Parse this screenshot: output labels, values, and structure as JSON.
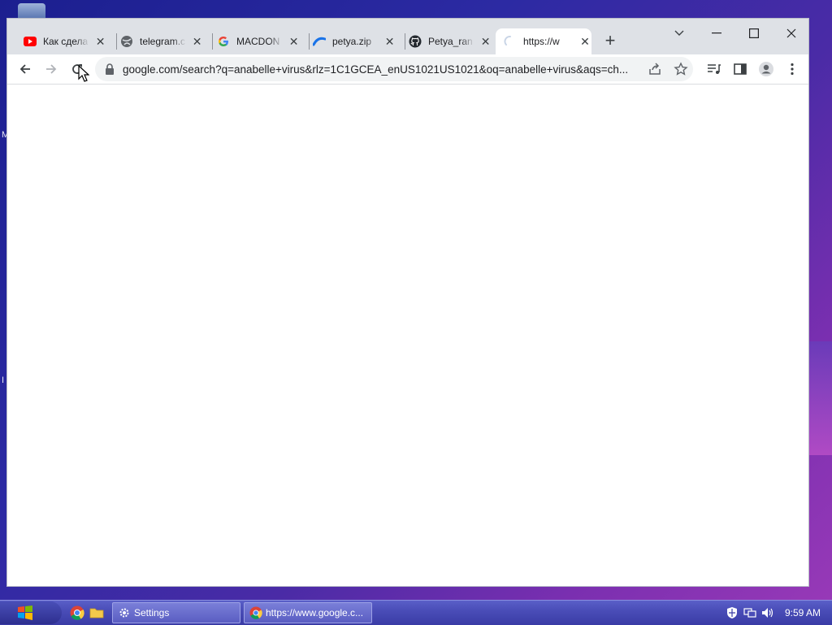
{
  "browser": {
    "tabs": [
      {
        "title": "Как сдела",
        "icon": "youtube-icon",
        "active": false
      },
      {
        "title": "telegram.c",
        "icon": "globe-icon",
        "active": false
      },
      {
        "title": "MACDON",
        "icon": "google-icon",
        "active": false
      },
      {
        "title": "petya.zip",
        "icon": "swoosh-icon",
        "active": false
      },
      {
        "title": "Petya_ran",
        "icon": "github-icon",
        "active": false
      },
      {
        "title": "https://w",
        "icon": "loading-spinner-icon",
        "active": true
      }
    ],
    "address_url": "google.com/search?q=anabelle+virus&rlz=1C1GCEA_enUS1021US1021&oq=anabelle+virus&aqs=ch..."
  },
  "taskbar": {
    "settings_label": "Settings",
    "chrome_task_label": "https://www.google.c...",
    "clock": "9:59 AM"
  },
  "desktop": {
    "letters": [
      "M",
      "I"
    ]
  },
  "colors": {
    "tabstrip": "#dee1e6",
    "omnibox": "#f1f3f4",
    "youtube_red": "#ff0000",
    "taskbar": "#4a4db8"
  }
}
